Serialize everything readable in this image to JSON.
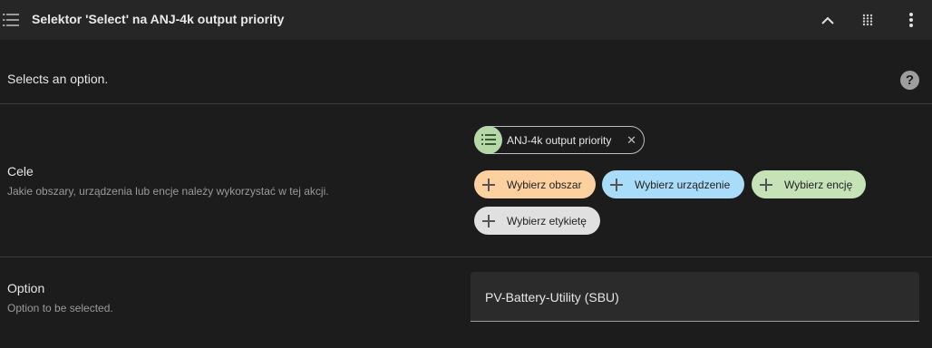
{
  "header": {
    "title": "Selektor 'Select' na ANJ-4k output priority",
    "icons": [
      "list-icon",
      "chevron-up-icon",
      "drag-handle-icon",
      "more-vert-icon"
    ]
  },
  "description": "Selects an option.",
  "help_icon": "?",
  "targets": {
    "title": "Cele",
    "subtitle": "Jakie obszary, urządzenia lub encje należy wykorzystać w tej akcji.",
    "selected": [
      {
        "label": "ANJ-4k output priority",
        "icon": "list-icon",
        "remove_icon": "✕"
      }
    ],
    "add_chips": [
      {
        "label": "Wybierz obszar",
        "color": "#fdd09f"
      },
      {
        "label": "Wybierz urządzenie",
        "color": "#a8dcf9"
      },
      {
        "label": "Wybierz encję",
        "color": "#c5e3b6"
      },
      {
        "label": "Wybierz etykietę",
        "color": "#e0e0e0"
      }
    ]
  },
  "option": {
    "title": "Option",
    "subtitle": "Option to be selected.",
    "value": "PV-Battery-Utility (SBU)"
  },
  "colors": {
    "background": "#1c1c1c",
    "header_background": "#262626",
    "entity_icon_bg": "#b6d7a8"
  }
}
